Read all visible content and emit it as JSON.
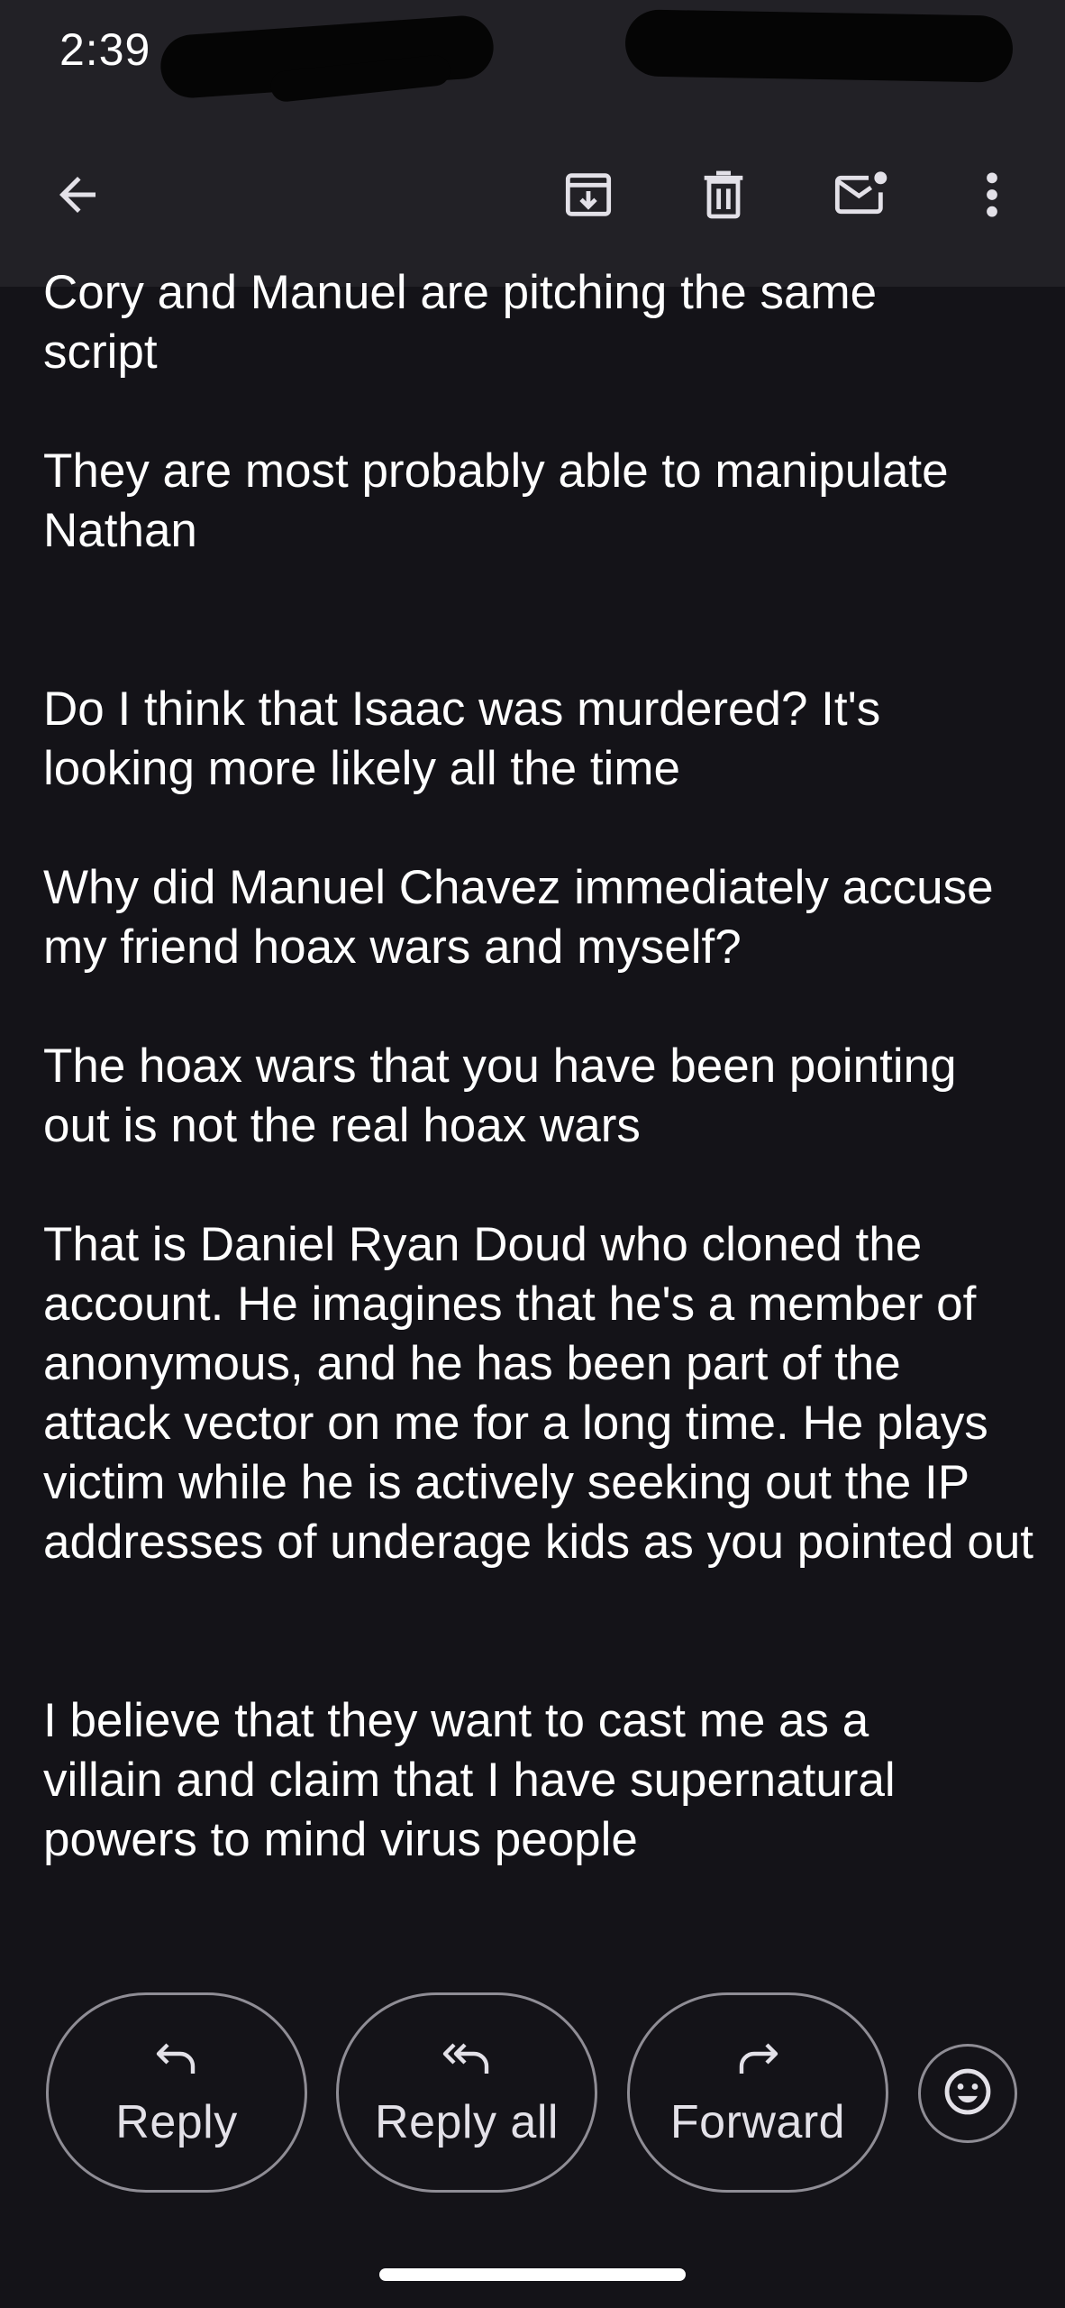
{
  "status_bar": {
    "time": "2:39"
  },
  "toolbar": {
    "back_icon": "arrow-left-icon",
    "archive_icon": "archive-icon",
    "delete_icon": "trash-icon",
    "mark_unread_icon": "mail-unread-icon",
    "more_icon": "more-vert-icon"
  },
  "email": {
    "paragraphs": [
      "Cory and Manuel are pitching the same script",
      "They are most probably able to manipulate Nathan",
      "Do I think that Isaac was murdered? It's looking more likely all the time",
      "Why did Manuel Chavez immediately accuse my friend hoax wars and myself?",
      "The hoax wars that you have been pointing out is not the real hoax wars",
      "That is Daniel Ryan Doud who cloned the account. He imagines that he's a member of anonymous, and he has been part of the attack vector on me for a long time. He plays victim while he is actively seeking out the IP addresses of underage kids as you pointed out",
      "I believe that they want to cast me as a villain and claim that I have supernatural powers to mind virus people"
    ]
  },
  "actions": {
    "reply_label": "Reply",
    "reply_all_label": "Reply all",
    "forward_label": "Forward",
    "emoji_icon": "smiley-icon"
  },
  "colors": {
    "background": "#141318",
    "bar": "#222126",
    "text": "#ffffff",
    "outline": "#8f8d95"
  }
}
